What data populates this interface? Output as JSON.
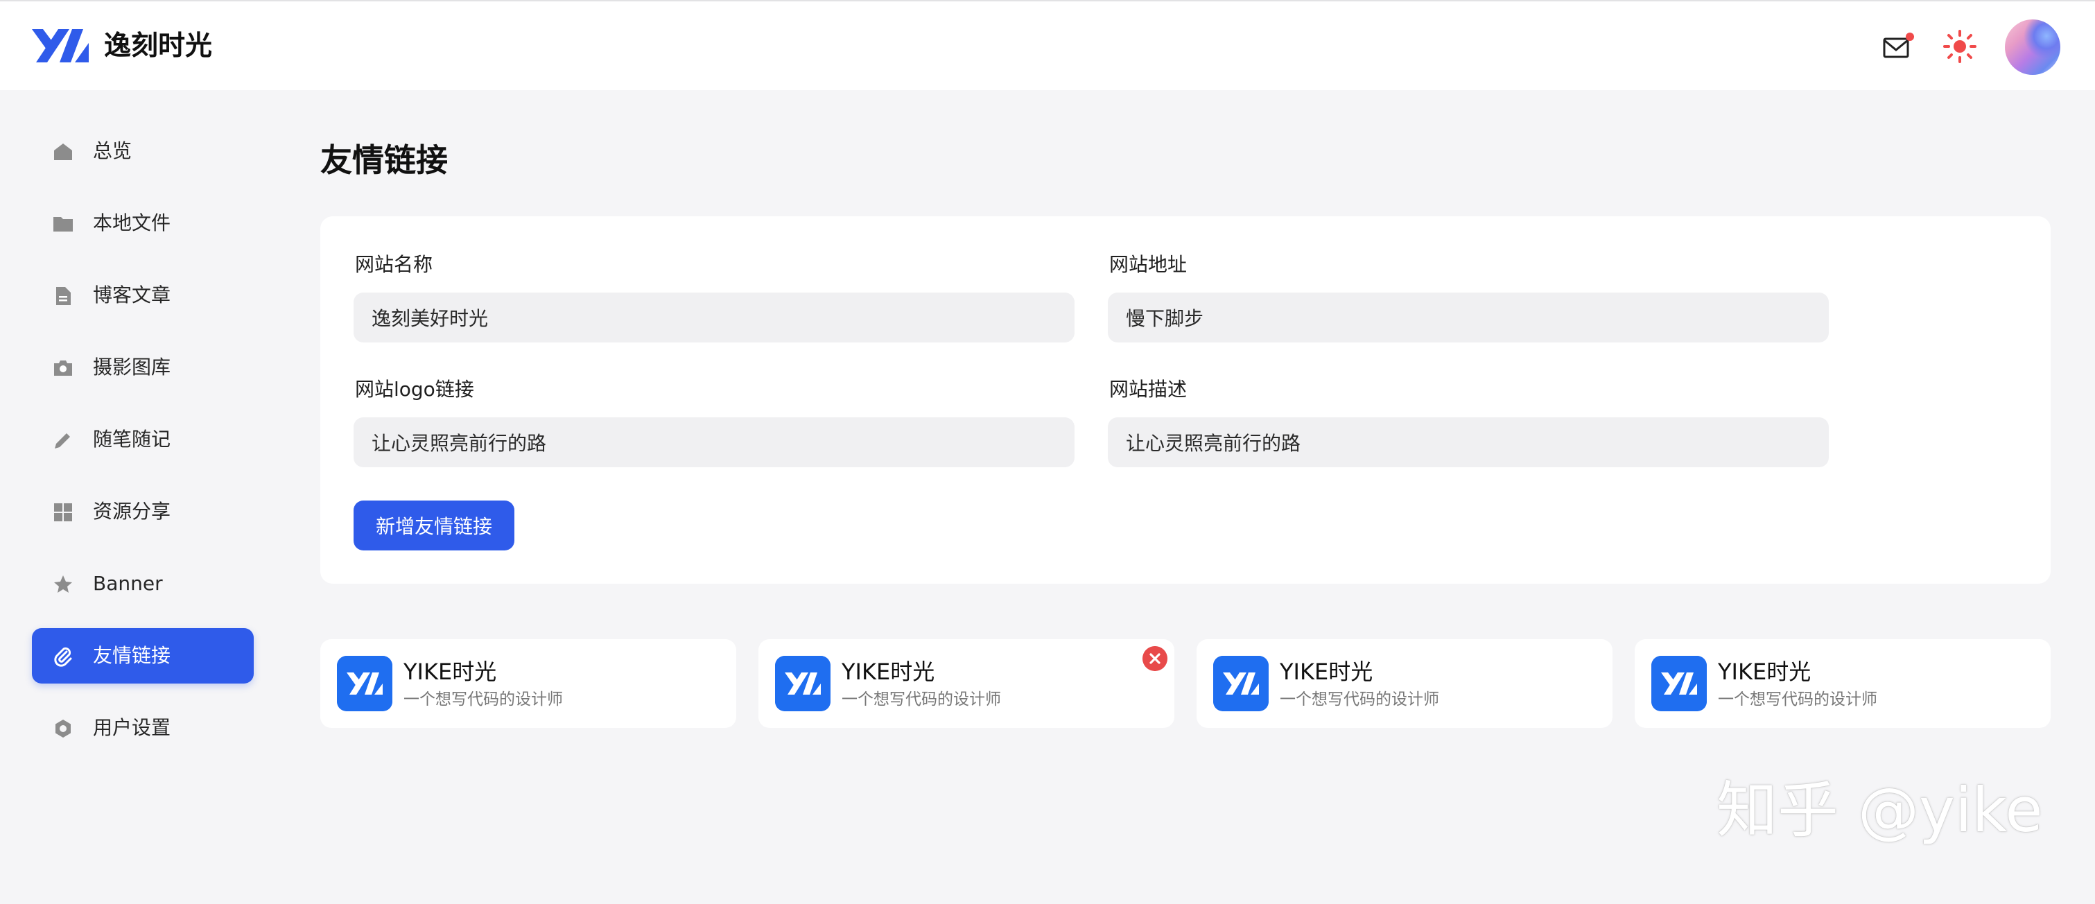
{
  "app": {
    "brand": "逸刻时光"
  },
  "header": {
    "icons": {
      "mail": "mail-icon",
      "theme": "sun-icon",
      "avatar": "avatar"
    },
    "notification_dot_color": "#f04a4a",
    "sun_color": "#f04a4a"
  },
  "sidebar": {
    "items": [
      {
        "label": "总览",
        "icon": "home-icon"
      },
      {
        "label": "本地文件",
        "icon": "folder-icon"
      },
      {
        "label": "博客文章",
        "icon": "document-icon"
      },
      {
        "label": "摄影图库",
        "icon": "camera-icon"
      },
      {
        "label": "随笔随记",
        "icon": "pencil-icon"
      },
      {
        "label": "资源分享",
        "icon": "grid-icon"
      },
      {
        "label": "Banner",
        "icon": "star-icon"
      },
      {
        "label": "友情链接",
        "icon": "paperclip-icon",
        "active": true
      },
      {
        "label": "用户设置",
        "icon": "gear-icon"
      }
    ]
  },
  "main": {
    "title": "友情链接",
    "form": {
      "site_name": {
        "label": "网站名称",
        "value": "逸刻美好时光"
      },
      "site_url": {
        "label": "网站地址",
        "value": "慢下脚步"
      },
      "logo_url": {
        "label": "网站logo链接",
        "value": "让心灵照亮前行的路"
      },
      "description": {
        "label": "网站描述",
        "value": "让心灵照亮前行的路"
      },
      "submit_label": "新增友情链接"
    },
    "links": [
      {
        "title": "YIKE时光",
        "description": "一个想写代码的设计师"
      },
      {
        "title": "YIKE时光",
        "description": "一个想写代码的设计师",
        "show_delete": true
      },
      {
        "title": "YIKE时光",
        "description": "一个想写代码的设计师"
      },
      {
        "title": "YIKE时光",
        "description": "一个想写代码的设计师"
      }
    ]
  },
  "watermark": "知乎 @yike",
  "colors": {
    "accent": "#2f5bea",
    "logo_blue": "#1f6ef0",
    "danger": "#e84a4a"
  }
}
